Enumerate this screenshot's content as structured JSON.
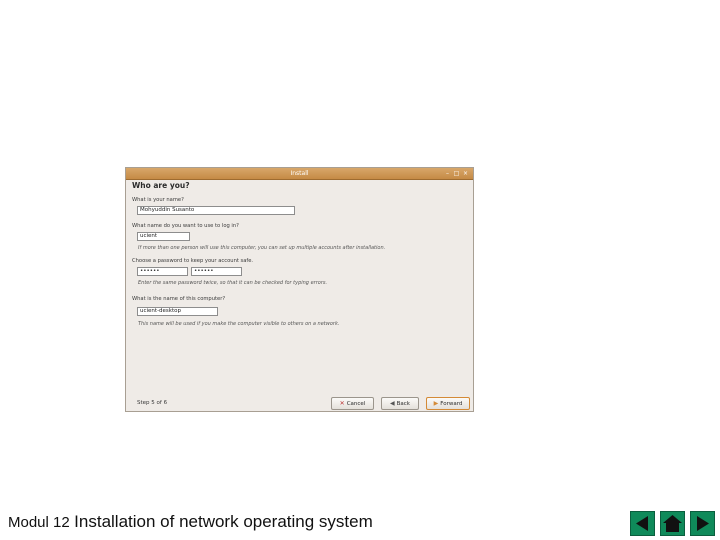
{
  "window": {
    "title": "Install",
    "controls": {
      "minimize": "–",
      "maximize": "□",
      "close": "×"
    }
  },
  "form": {
    "heading": "Who are you?",
    "name_label": "What is your name?",
    "name_value": "Mohyuddin Susanto",
    "login_label": "What name do you want to use to log in?",
    "login_value": "ucient",
    "login_hint": "If more than one person will use this computer, you can set up multiple accounts after installation.",
    "password_label": "Choose a password to keep your account safe.",
    "password_value": "••••••",
    "password_confirm_value": "••••••",
    "password_hint": "Enter the same password twice, so that it can be checked for typing errors.",
    "computer_label": "What is the name of this computer?",
    "computer_value": "ucient-desktop",
    "computer_hint": "This name will be used if you make the computer visible to others on a network."
  },
  "footer_bar": {
    "step": "Step 5 of 6",
    "cancel_label": "Cancel",
    "back_label": "Back",
    "forward_label": "Forward"
  },
  "slide": {
    "footer_prefix": "Modul 12",
    "footer_title": "Installation of network operating system"
  },
  "icons": {
    "cancel": "✕",
    "back": "◀",
    "forward": "▶",
    "nav_prev": "prev-arrow-icon",
    "nav_home": "home-icon",
    "nav_next": "next-arrow-icon"
  },
  "colors": {
    "titlebar": "#c58a45",
    "nav_button": "#0f8a5a",
    "nav_glyph": "#111111"
  }
}
